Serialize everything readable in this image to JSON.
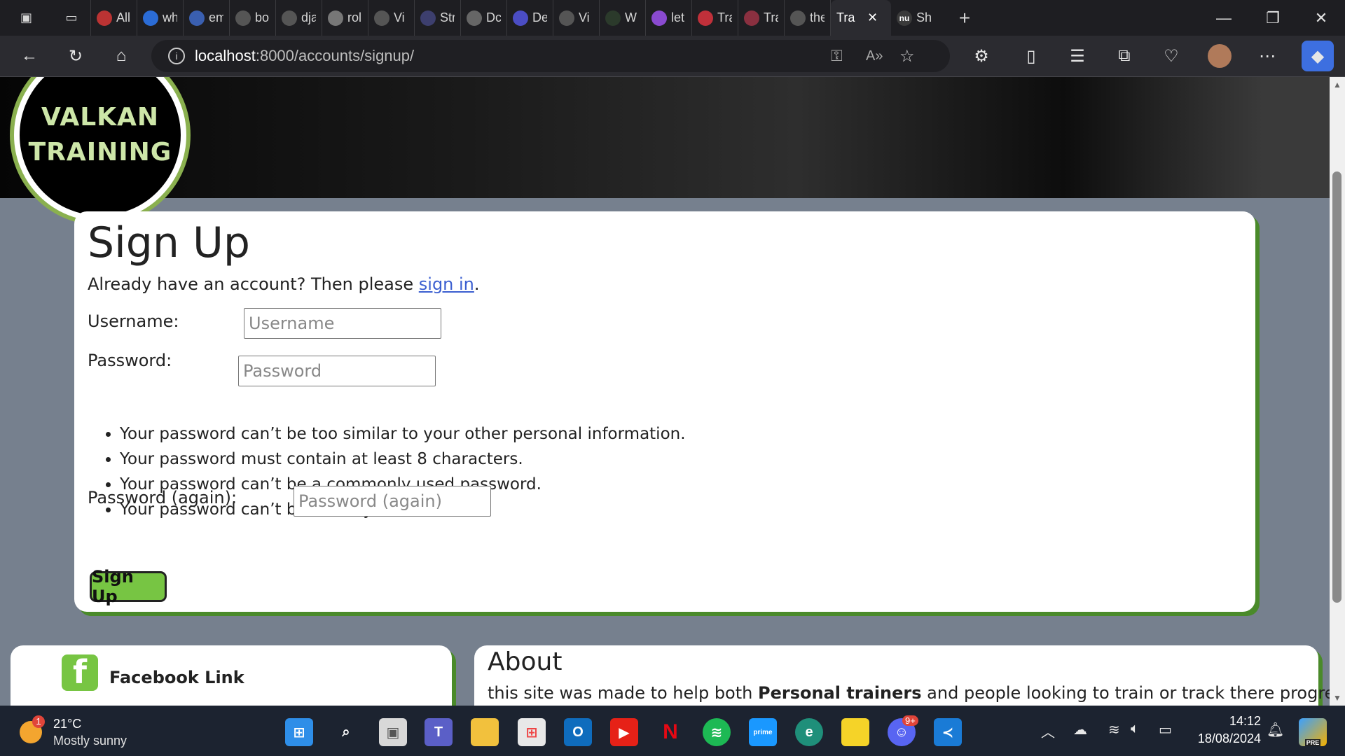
{
  "browser": {
    "tabs": [
      {
        "short": "All",
        "icon": "opera-icon",
        "color": "#b33"
      },
      {
        "short": "wh",
        "icon": "bing-icon",
        "color": "#2b6cd6"
      },
      {
        "short": "em",
        "icon": "search-icon",
        "color": "#3a5fb0"
      },
      {
        "short": "bo",
        "icon": "github-icon",
        "color": "#555"
      },
      {
        "short": "dja",
        "icon": "github-icon",
        "color": "#555"
      },
      {
        "short": "rol",
        "icon": "google-icon",
        "color": "#777"
      },
      {
        "short": "Vi",
        "icon": "github-icon",
        "color": "#555"
      },
      {
        "short": "Str",
        "icon": "s-icon",
        "color": "#3d3f6e"
      },
      {
        "short": "Dc",
        "icon": "g-icon",
        "color": "#666"
      },
      {
        "short": "De",
        "icon": "s-icon",
        "color": "#4b4dc4"
      },
      {
        "short": "Vi",
        "icon": "github-icon",
        "color": "#555"
      },
      {
        "short": "W",
        "icon": "dj-icon",
        "color": "#2b3a2b"
      },
      {
        "short": "let",
        "icon": "k-icon",
        "color": "#8a4ad0"
      },
      {
        "short": "Tra",
        "icon": "app-icon",
        "color": "#c0303a"
      },
      {
        "short": "Tra",
        "icon": "app-icon",
        "color": "#8a3040"
      },
      {
        "short": "the",
        "icon": "github-icon",
        "color": "#555"
      }
    ],
    "active_tab": {
      "short": "Tra"
    },
    "next_tab": {
      "short": "Sh",
      "icon_text": "nu"
    },
    "url_host": "localhost",
    "url_path": ":8000/accounts/signup/"
  },
  "logo": {
    "line1": "VALKAN",
    "line2": "TRAINING"
  },
  "signup": {
    "title": "Sign Up",
    "already_prefix": "Already have an account? Then please ",
    "signin_link": "sign in",
    "already_suffix": ".",
    "username_label": "Username:",
    "username_placeholder": "Username",
    "password_label": "Password:",
    "password_placeholder": "Password",
    "rules": [
      "Your password can’t be too similar to your other personal information.",
      "Your password must contain at least 8 characters.",
      "Your password can’t be a commonly used password.",
      "Your password can’t be entirely numeric."
    ],
    "password2_label": "Password (again):",
    "password2_placeholder": "Password (again)",
    "submit_label": "Sign Up"
  },
  "footer": {
    "facebook_label": "Facebook Link",
    "about_title": "About",
    "about_text_1": "this site was made to help both ",
    "about_bold": "Personal trainers",
    "about_text_2": " and people looking to train or track there progress, we also"
  },
  "taskbar": {
    "weather_temp": "21°C",
    "weather_desc": "Mostly sunny",
    "weather_badge": "1",
    "time": "14:12",
    "date": "18/08/2024",
    "discord_badge": "9+",
    "copilot_badge": "PRE"
  },
  "colors": {
    "accent_green": "#77c543",
    "card_shadow": "#4a8a2a",
    "page_bg": "#76808e",
    "link": "#3b5fd0"
  }
}
